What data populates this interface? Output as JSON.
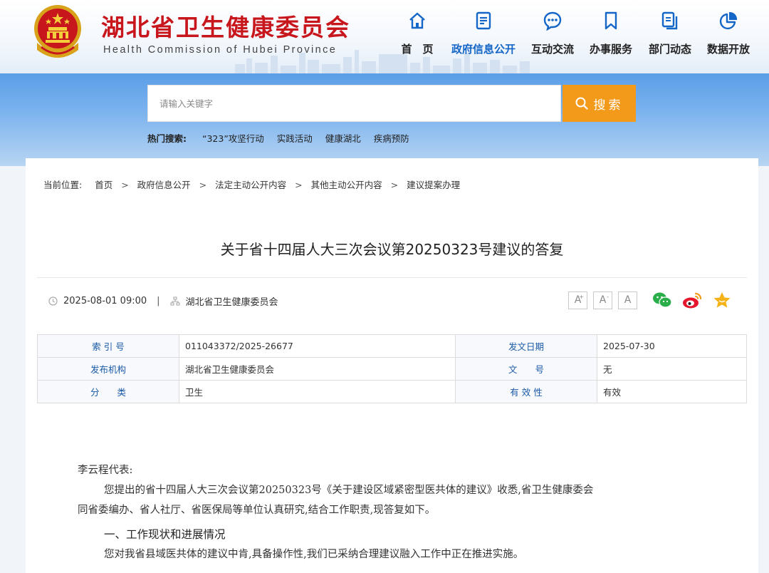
{
  "header": {
    "title": "湖北省卫生健康委员会",
    "subtitle": "Health Commission of Hubei Province",
    "nav": [
      {
        "label": "首　页",
        "icon": "home-icon"
      },
      {
        "label": "政府信息公开",
        "icon": "document-list-icon"
      },
      {
        "label": "互动交流",
        "icon": "chat-bubble-icon"
      },
      {
        "label": "办事服务",
        "icon": "bookmark-icon"
      },
      {
        "label": "部门动态",
        "icon": "copy-document-icon"
      },
      {
        "label": "数据开放",
        "icon": "pie-chart-icon"
      }
    ],
    "active_nav": "政府信息公开",
    "accent_color": "#c8161d",
    "nav_active_color": "#1466c7"
  },
  "search": {
    "placeholder": "请输入关键字",
    "button_label": "搜索",
    "button_color": "#f39a1b",
    "hot_label": "热门搜索:",
    "hot_keywords": [
      "“323”攻坚行动",
      "实践活动",
      "健康湖北",
      "疾病预防"
    ]
  },
  "breadcrumb": {
    "label": "当前位置:",
    "items": [
      "首页",
      "政府信息公开",
      "法定主动公开内容",
      "其他主动公开内容",
      "建议提案办理"
    ]
  },
  "article": {
    "title": "关于省十四届人大三次会议第20250323号建议的答复",
    "date": "2025-08-01 09:00",
    "source": "湖北省卫生健康委员会",
    "font_buttons": [
      "A+",
      "A-",
      "A"
    ],
    "share_icons": [
      "wechat-icon",
      "weibo-icon",
      "favorite-star-icon"
    ]
  },
  "info_table": [
    [
      {
        "k": "索 引 号",
        "v": "011043372/2025-26677"
      },
      {
        "k": "发文日期",
        "v": "2025-07-30"
      }
    ],
    [
      {
        "k": "发布机构",
        "v": "湖北省卫生健康委员会"
      },
      {
        "k": "文　　号",
        "v": "无"
      }
    ],
    [
      {
        "k": "分　　类",
        "v": "卫生"
      },
      {
        "k": "有 效 性",
        "v": "有效"
      }
    ]
  ],
  "body": {
    "salutation": "李云程代表:",
    "para1_line1": "您提出的省十四届人大三次会议第20250323号《关于建设区域紧密型医共体的建议》收悉,省卫生健康委会",
    "para1_line2": "同省委编办、省人社厅、省医保局等单位认真研究,结合工作职责,现答复如下。",
    "heading1": "一、工作现状和进展情况",
    "para2": "您对我省县域医共体的建议中肯,具备操作性,我们已采纳合理建议融入工作中正在推进实施。"
  }
}
